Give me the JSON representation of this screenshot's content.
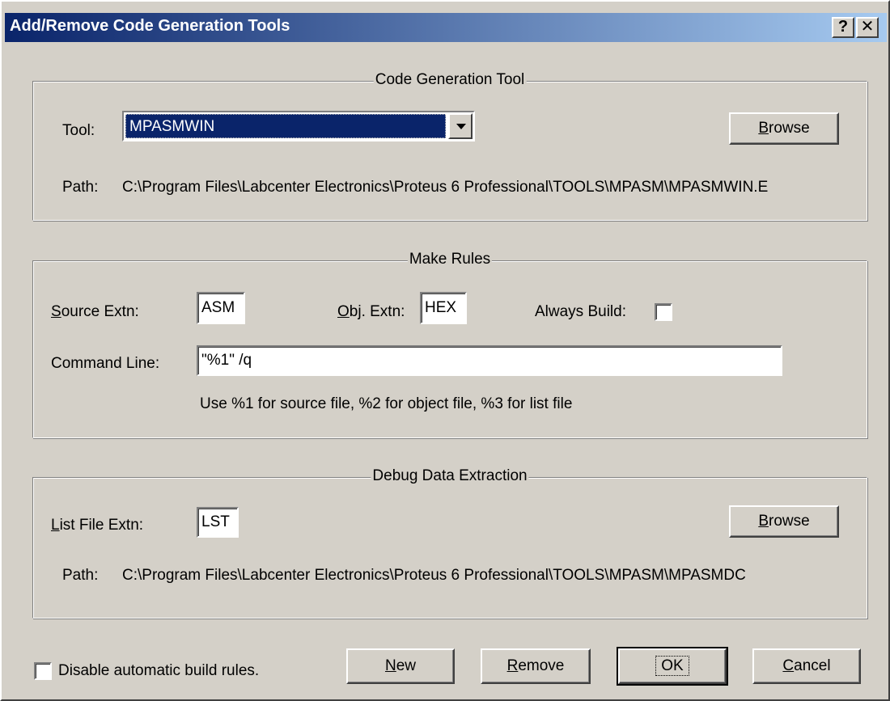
{
  "window": {
    "title": "Add/Remove Code Generation Tools",
    "help_label": "?",
    "close_label": "✕"
  },
  "code_gen": {
    "legend": "Code Generation Tool",
    "tool_label": "Tool:",
    "tool_value": "MPASMWIN",
    "browse_label": "Browse",
    "path_label": "Path:",
    "path_value": "C:\\Program Files\\Labcenter Electronics\\Proteus 6 Professional\\TOOLS\\MPASM\\MPASMWIN.E"
  },
  "make_rules": {
    "legend": "Make Rules",
    "source_extn_label": "Source Extn:",
    "source_extn_value": "ASM",
    "obj_extn_label": "Obj. Extn:",
    "obj_extn_value": "HEX",
    "always_build_label": "Always Build:",
    "always_build_checked": false,
    "command_line_label": "Command Line:",
    "command_line_value": "\"%1\" /q",
    "hint": "Use %1 for source file, %2 for object file, %3 for list file"
  },
  "debug": {
    "legend": "Debug Data Extraction",
    "list_extn_label": "List File Extn:",
    "list_extn_value": "LST",
    "browse_label": "Browse",
    "path_label": "Path:",
    "path_value": "C:\\Program Files\\Labcenter Electronics\\Proteus 6 Professional\\TOOLS\\MPASM\\MPASMDC"
  },
  "footer": {
    "disable_rules_label": "Disable automatic build rules.",
    "disable_rules_checked": false,
    "new_label": "New",
    "remove_label": "Remove",
    "ok_label": "OK",
    "cancel_label": "Cancel"
  }
}
